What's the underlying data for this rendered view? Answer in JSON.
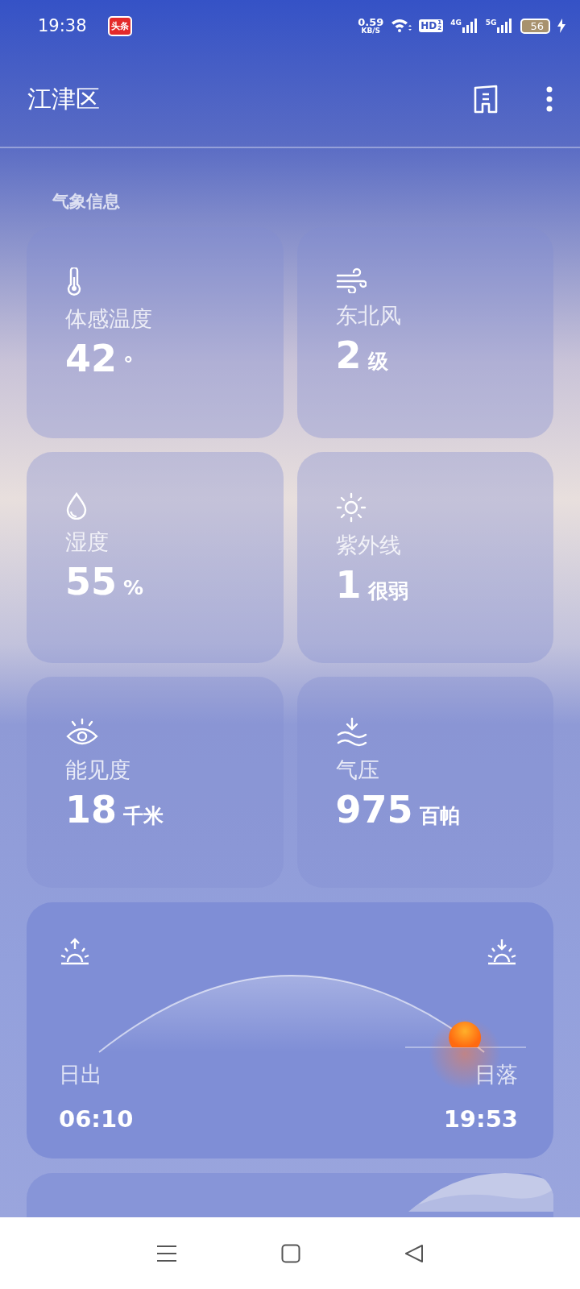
{
  "status_bar": {
    "time": "19:38",
    "app_badge": "头条",
    "speed": "0.59",
    "speed_unit": "KB/S",
    "hd": "HD",
    "hd_sims": [
      "1",
      "2"
    ],
    "networks": [
      "4G",
      "5G"
    ],
    "battery": "56",
    "charging": true
  },
  "header": {
    "title": "江津区"
  },
  "section_title": "气象信息",
  "tiles": [
    {
      "kind": "thermometer",
      "label": "体感温度",
      "value": "42",
      "unit": "°"
    },
    {
      "kind": "wind",
      "label": "东北风",
      "value": "2",
      "unit": "级"
    },
    {
      "kind": "droplet",
      "label": "湿度",
      "value": "55",
      "unit": "%"
    },
    {
      "kind": "sun",
      "label": "紫外线",
      "value": "1",
      "unit": "很弱"
    },
    {
      "kind": "eye",
      "label": "能见度",
      "value": "18",
      "unit": "千米"
    },
    {
      "kind": "pressure",
      "label": "气压",
      "value": "975",
      "unit": "百帕"
    }
  ],
  "sun": {
    "sunrise_label": "日出",
    "sunrise_time": "06:10",
    "sunset_label": "日落",
    "sunset_time": "19:53"
  }
}
